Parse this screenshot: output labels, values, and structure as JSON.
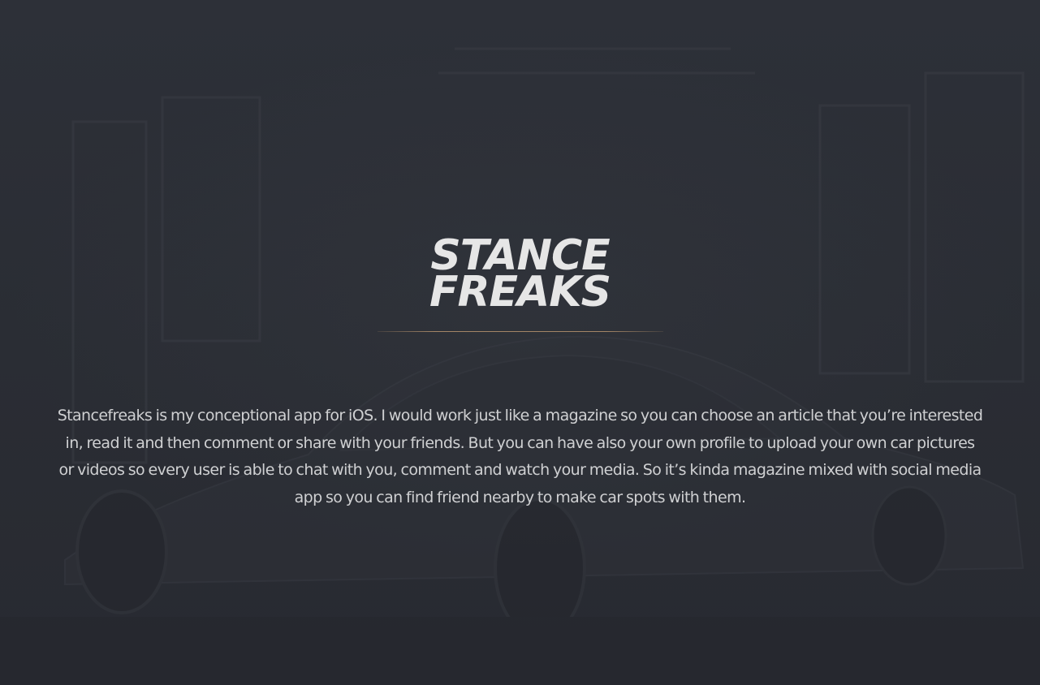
{
  "hero": {
    "logo_line1": "STANCE",
    "logo_line2": "FREAKS",
    "description": "Stancefreaks is my conceptional app for iOS. I would work just like a magazine so you can choose an article that you’re interested in, read it and then comment or share with your friends. But you can have also your own profile to upload your own car pictures or videos so every user is able to chat with you, comment and watch your media. So it’s kinda magazine mixed with social media app so you can find friend nearby to make car spots with them."
  },
  "colors": {
    "background": "#2b2e35",
    "accent_line": "#a28465",
    "text": "#cfd0d2",
    "logo": "#e6e6e6"
  }
}
